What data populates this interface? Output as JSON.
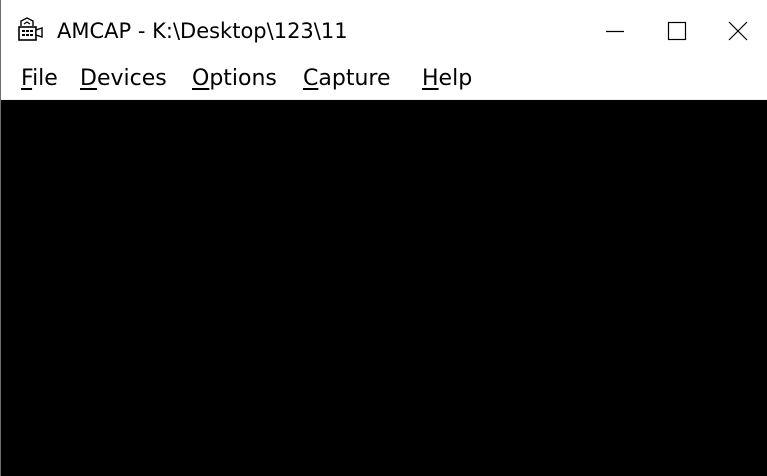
{
  "window": {
    "title": "AMCAP - K:\\Desktop\\123\\11",
    "app_icon": "amcap-camera-icon",
    "controls": {
      "minimize_icon": "minimize-icon",
      "maximize_icon": "maximize-icon",
      "close_icon": "close-icon"
    }
  },
  "menubar": {
    "items": [
      {
        "mnemonic": "F",
        "rest": "ile"
      },
      {
        "mnemonic": "D",
        "rest": "evices"
      },
      {
        "mnemonic": "O",
        "rest": "ptions"
      },
      {
        "mnemonic": "C",
        "rest": "apture"
      },
      {
        "mnemonic": "H",
        "rest": "elp"
      }
    ]
  },
  "colors": {
    "preview_background": "#000000",
    "window_background": "#ffffff",
    "text": "#000000"
  }
}
